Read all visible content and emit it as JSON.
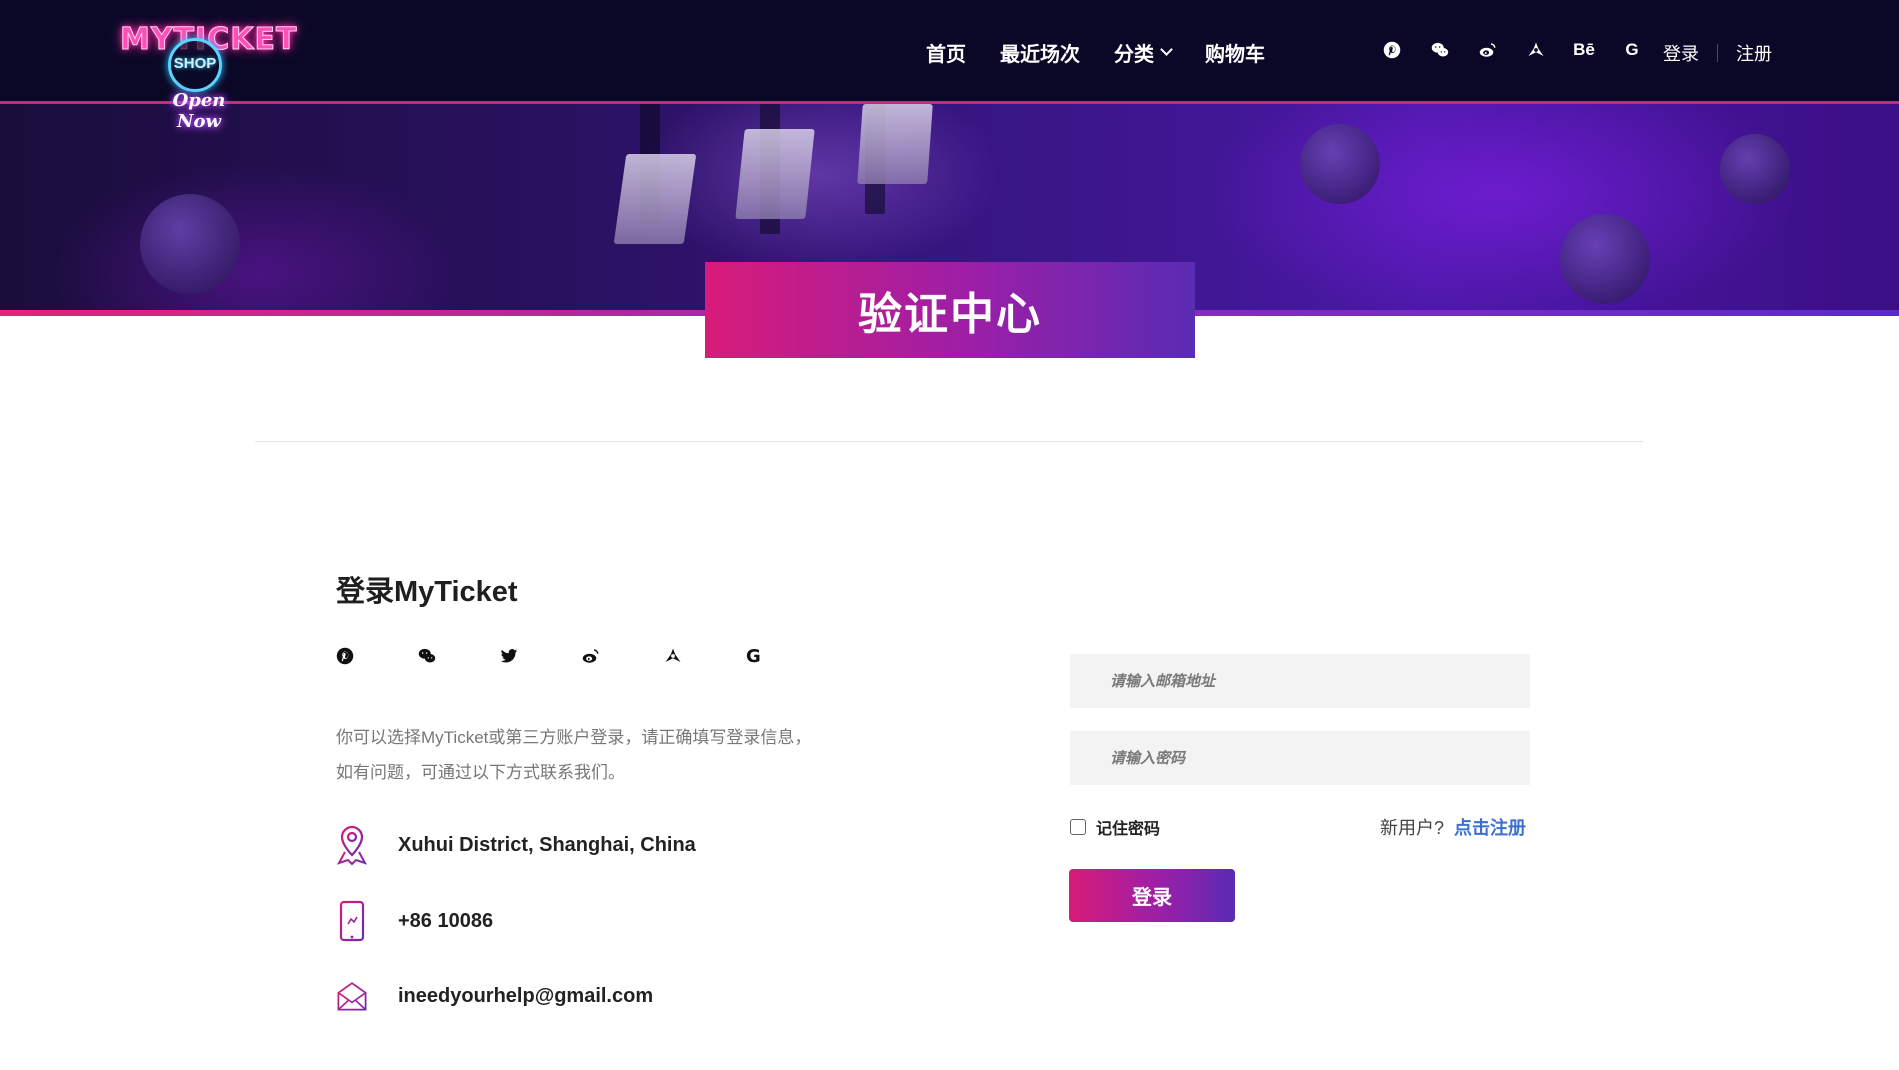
{
  "logo": {
    "title": "MYTICKET",
    "badge": "SHOP",
    "tagline": "Open Now"
  },
  "nav": {
    "items": [
      {
        "label": "首页"
      },
      {
        "label": "最近场次"
      },
      {
        "label": "分类"
      },
      {
        "label": "购物车"
      }
    ]
  },
  "header_social": [
    "pinterest-icon",
    "wechat-icon",
    "weibo-icon",
    "aperture-icon",
    "behance-icon",
    "google-icon"
  ],
  "header_social_text": {
    "behance": "Bē",
    "google": "G"
  },
  "auth": {
    "login": "登录",
    "register": "注册"
  },
  "hero": {
    "title": "验证中心"
  },
  "login": {
    "heading": "登录MyTicket",
    "description_line1": "你可以选择MyTicket或第三方账户登录，请正确填写登录信息，",
    "description_line2": "如有问题，可通过以下方式联系我们。"
  },
  "social_login": [
    "pinterest-icon",
    "wechat-icon",
    "twitter-icon",
    "weibo-icon",
    "aperture-icon",
    "google-icon"
  ],
  "contact": {
    "address": "Xuhui District, Shanghai, China",
    "phone": "+86 10086",
    "email": "ineedyourhelp@gmail.com"
  },
  "form": {
    "email_placeholder": "请输入邮箱地址",
    "password_placeholder": "请输入密码",
    "remember_label": "记住密码",
    "new_user_label": "新用户?",
    "register_link": "点击注册",
    "submit_label": "登录"
  },
  "colors": {
    "header_bg": "#0b0827",
    "accent_pink": "#d81b79",
    "accent_purple": "#5a2bb3",
    "link_blue": "#3b6fd0"
  }
}
